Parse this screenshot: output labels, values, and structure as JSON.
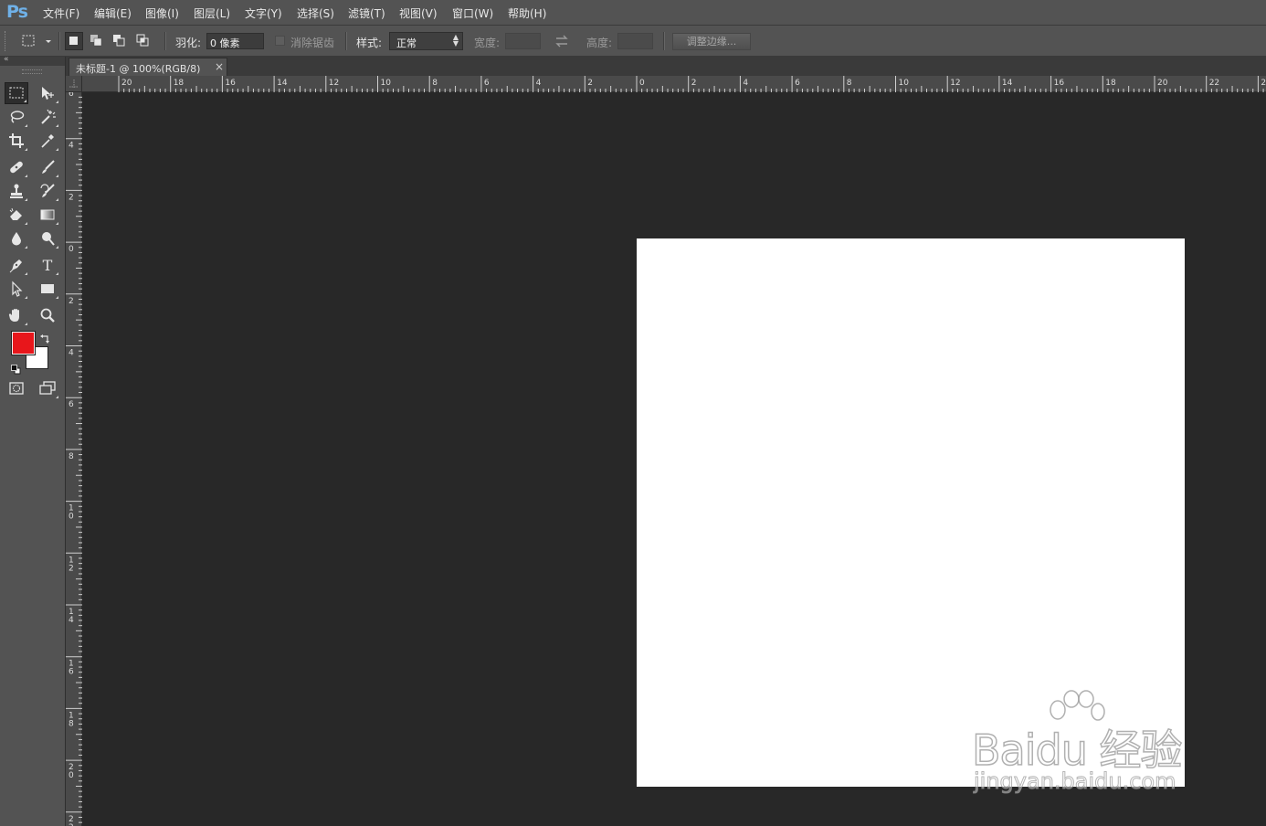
{
  "app": {
    "logo": "Ps"
  },
  "menu": [
    "文件(F)",
    "编辑(E)",
    "图像(I)",
    "图层(L)",
    "文字(Y)",
    "选择(S)",
    "滤镜(T)",
    "视图(V)",
    "窗口(W)",
    "帮助(H)"
  ],
  "options": {
    "feather_label": "羽化:",
    "feather_value": "0 像素",
    "antialias_label": "消除锯齿",
    "style_label": "样式:",
    "style_value": "正常",
    "width_label": "宽度:",
    "height_label": "高度:",
    "refine_edge_button": "调整边缘..."
  },
  "document": {
    "tab_title": "未标题-1 @ 100%(RGB/8)",
    "close_glyph": "×"
  },
  "rulers": {
    "horizontal_labels": [
      "20",
      "18",
      "16",
      "14",
      "12",
      "10",
      "8",
      "6",
      "4",
      "2",
      "0",
      "2",
      "4",
      "6",
      "8",
      "10",
      "12",
      "14",
      "16",
      "18",
      "20",
      "22",
      "2"
    ],
    "vertical_labels": [
      "6",
      "4",
      "2",
      "0",
      "2",
      "4",
      "6",
      "8",
      "10",
      "12",
      "14",
      "16",
      "18",
      "20",
      "22"
    ]
  },
  "colors": {
    "foreground": "#e8161b",
    "background": "#ffffff",
    "canvas": "#ffffff",
    "workspace": "#282828"
  },
  "tools": [
    "rectangular-marquee-tool",
    "move-tool",
    "lasso-tool",
    "magic-wand-tool",
    "crop-tool",
    "eyedropper-tool",
    "healing-brush-tool",
    "brush-tool",
    "clone-stamp-tool",
    "history-brush-tool",
    "eraser-tool",
    "gradient-tool",
    "blur-tool",
    "dodge-tool",
    "pen-tool",
    "type-tool",
    "path-selection-tool",
    "rectangle-tool",
    "hand-tool",
    "zoom-tool"
  ],
  "watermark": {
    "brand": "Bai",
    "brand_suffix": "du 经验",
    "url": "jingyan.baidu.com"
  }
}
